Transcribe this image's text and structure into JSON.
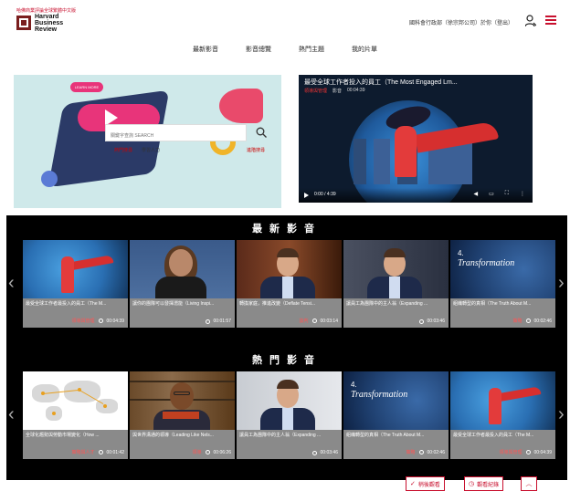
{
  "header": {
    "tagline": "哈佛商業評論全球繁體中文版",
    "logo_name": "Harvard Business Review",
    "user_text": "國科會行政部（徐宗邦公司）於你（登出）",
    "logout_label": "登出",
    "user_icon": "user-icon",
    "menu_icon": "menu-icon"
  },
  "nav": {
    "items": [
      "最新影音",
      "影音總覽",
      "熱門主題",
      "我的片單"
    ]
  },
  "hero_left": {
    "learn_more_label": "LEARN MORE",
    "search_placeholder": "關鍵字查詢 SEARCH",
    "search_links": [
      "熱門搜尋",
      "學習人力"
    ],
    "advanced_search_label": "進階搜尋"
  },
  "hero_video": {
    "title": "最受全球工作者投入的員工（The Most Engaged Lm...",
    "tag": "領導與管理",
    "meta_1": "影音",
    "meta_2": "00:04:39",
    "time_display": "0:00 / 4:39",
    "control_icons": [
      "volume-icon",
      "pip-icon",
      "fullscreen-icon",
      "more-icon"
    ]
  },
  "latest": {
    "section_title": "最新影音",
    "videos": [
      {
        "title": "最受全球工作者最投入的員工（The M...",
        "tag": "領導與管理",
        "duration": "00:04:39",
        "thumb": "hero"
      },
      {
        "title": "讓你的團隊可以發揮潛能（Living Inspi...",
        "tag": "",
        "duration": "00:01:57",
        "thumb": "woman"
      },
      {
        "title": "轉換家庭，推進改變（Deflate Tensi...",
        "tag": "談判",
        "duration": "00:03:14",
        "thumb": "man1"
      },
      {
        "title": "讓員工為團隊中的主人翁（Expanding ...",
        "tag": "",
        "duration": "00:03:46",
        "thumb": "man2"
      },
      {
        "title": "組織轉型的真相（The Truth About M...",
        "tag": "策略",
        "duration": "00:02:46",
        "thumb": "transform"
      }
    ]
  },
  "popular": {
    "section_title": "熱門影音",
    "videos": [
      {
        "title": "全球化趨勢與勞動市場變化（How ...",
        "tag": "策略與人才",
        "duration": "00:01:42",
        "thumb": "map"
      },
      {
        "title": "與世界溝通的領導（Leading Like Nels...",
        "tag": "領導",
        "duration": "00:06:26",
        "thumb": "bald"
      },
      {
        "title": "讓員工為團隊中的主人翁（Expanding ...",
        "tag": "",
        "duration": "00:03:46",
        "thumb": "man3"
      },
      {
        "title": "組織轉型的真相（The Truth About M...",
        "tag": "策略",
        "duration": "00:02:46",
        "thumb": "transform"
      },
      {
        "title": "最受全球工作者最投入的員工（The M...",
        "tag": "領導與管理",
        "duration": "00:04:39",
        "thumb": "hero"
      }
    ]
  },
  "float_bar": {
    "watch_later_label": "稍後觀看",
    "history_label": "觀看紀錄",
    "back_to_top_icon": "chevron-up-icon"
  },
  "colors": {
    "brand_red": "#c8102e",
    "section_bg": "#000000",
    "card_info_bg": "#8a8a8a"
  }
}
